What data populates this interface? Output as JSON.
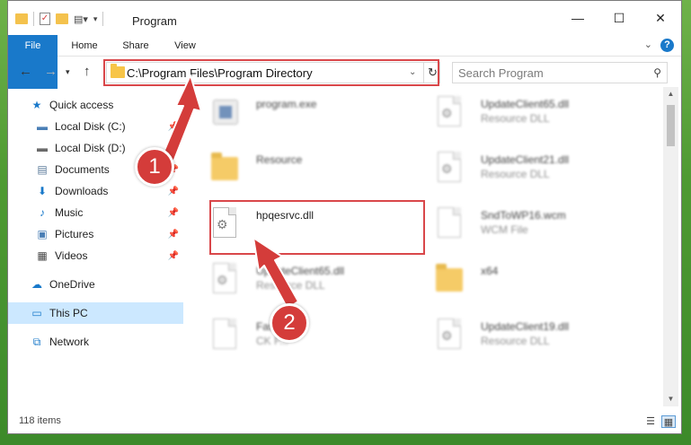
{
  "window": {
    "title": "Program",
    "controls": {
      "minimize": "—",
      "maximize": "☐",
      "close": "✕"
    }
  },
  "ribbon": {
    "tabs": [
      "File",
      "Home",
      "Share",
      "View"
    ],
    "help": "?"
  },
  "address": {
    "path": "C:\\Program Files\\Program Directory",
    "refresh_icon": "↻"
  },
  "search": {
    "placeholder": "Search Program"
  },
  "sidebar": {
    "items": [
      {
        "label": "Quick access",
        "icon": "star-icon",
        "glyph": "★",
        "pinned": false
      },
      {
        "label": "Local Disk (C:)",
        "icon": "drive-icon",
        "glyph": "▬",
        "pinned": true
      },
      {
        "label": "Local Disk (D:)",
        "icon": "drive-icon",
        "glyph": "▬",
        "pinned": true
      },
      {
        "label": "Documents",
        "icon": "documents-icon",
        "glyph": "▤",
        "pinned": true
      },
      {
        "label": "Downloads",
        "icon": "downloads-icon",
        "glyph": "⬇",
        "pinned": true
      },
      {
        "label": "Music",
        "icon": "music-icon",
        "glyph": "♪",
        "pinned": true
      },
      {
        "label": "Pictures",
        "icon": "pictures-icon",
        "glyph": "▣",
        "pinned": true
      },
      {
        "label": "Videos",
        "icon": "videos-icon",
        "glyph": "▦",
        "pinned": true
      },
      {
        "label": "OneDrive",
        "icon": "cloud-icon",
        "glyph": "☁",
        "pinned": false
      },
      {
        "label": "This PC",
        "icon": "pc-icon",
        "glyph": "▭",
        "pinned": false
      },
      {
        "label": "Network",
        "icon": "network-icon",
        "glyph": "⧉",
        "pinned": false
      }
    ]
  },
  "files": [
    {
      "name": "program.exe",
      "type": "",
      "kind": "exe"
    },
    {
      "name": "UpdateClient65.dll",
      "type": "Resource DLL",
      "kind": "dll"
    },
    {
      "name": "Resource",
      "type": "",
      "kind": "folder"
    },
    {
      "name": "UpdateClient21.dll",
      "type": "Resource DLL",
      "kind": "dll"
    },
    {
      "name": "hpqesrvc.dll",
      "type": "",
      "kind": "dll"
    },
    {
      "name": "SndToWP16.wcm",
      "type": "WCM File",
      "kind": "doc"
    },
    {
      "name": "UpdateClient65.dll",
      "type": "Resource DLL",
      "kind": "dll"
    },
    {
      "name": "x64",
      "type": "",
      "kind": "folder"
    },
    {
      "name": "Fast...",
      "type": "CK F...",
      "kind": "doc"
    },
    {
      "name": "UpdateClient19.dll",
      "type": "Resource DLL",
      "kind": "dll"
    }
  ],
  "callouts": {
    "step1": "1",
    "step2": "2"
  },
  "status": {
    "count": "118 items"
  },
  "colors": {
    "accent": "#1979ca",
    "highlight": "#d9474a",
    "selected": "#cce8ff"
  }
}
